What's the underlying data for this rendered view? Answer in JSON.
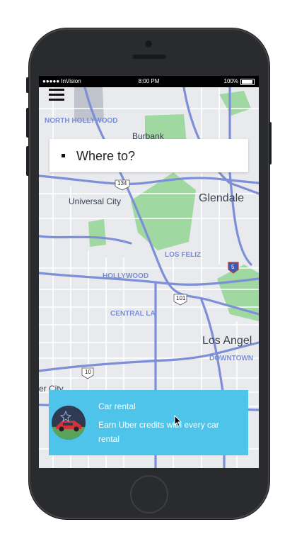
{
  "status_bar": {
    "carrier": "●●●●● InVision",
    "time": "8:00 PM",
    "battery": "100%"
  },
  "search": {
    "placeholder_label": "Where to?"
  },
  "map_labels": {
    "north_hollywood": "NORTH HOLLYWOOD",
    "burbank": "Burbank",
    "glendale": "Glendale",
    "universal_city": "Universal City",
    "los_feliz": "LOS FELIZ",
    "hollywood": "HOLLYWOOD",
    "central_la": "CENTRAL LA",
    "los_angeles": "Los Angel",
    "downtown": "DOWNTOWN",
    "culver_city": "er City",
    "highway_134": "134",
    "highway_101": "101",
    "highway_10": "10",
    "highway_5": "5"
  },
  "promo": {
    "title": "Car rental",
    "description": "Earn Uber credits with every car rental"
  },
  "colors": {
    "map_bg": "#e8eaed",
    "road": "#7d8fd6",
    "park": "#9fd8a0",
    "promo_bg": "#4ec4ea",
    "phone_body": "#2a2b2e"
  },
  "icons": [
    "menu-icon",
    "wifi-icon",
    "battery-icon",
    "car-rental-icon",
    "cursor-icon"
  ]
}
